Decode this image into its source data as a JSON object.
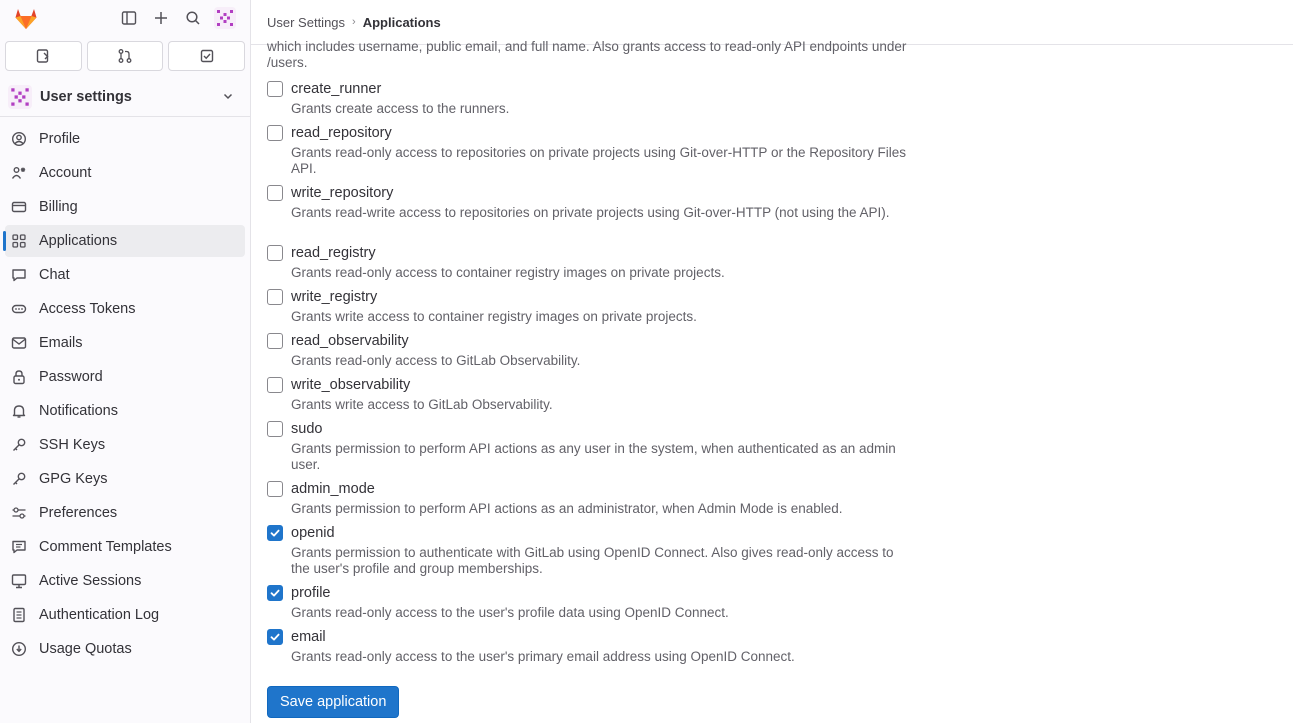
{
  "sidebar": {
    "context_title": "User settings",
    "items": [
      {
        "label": "Profile",
        "icon": "profile-icon"
      },
      {
        "label": "Account",
        "icon": "account-icon"
      },
      {
        "label": "Billing",
        "icon": "billing-icon"
      },
      {
        "label": "Applications",
        "icon": "applications-icon",
        "active": true
      },
      {
        "label": "Chat",
        "icon": "chat-icon"
      },
      {
        "label": "Access Tokens",
        "icon": "token-icon"
      },
      {
        "label": "Emails",
        "icon": "email-icon"
      },
      {
        "label": "Password",
        "icon": "lock-icon"
      },
      {
        "label": "Notifications",
        "icon": "bell-icon"
      },
      {
        "label": "SSH Keys",
        "icon": "key-icon"
      },
      {
        "label": "GPG Keys",
        "icon": "key-icon"
      },
      {
        "label": "Preferences",
        "icon": "preferences-icon"
      },
      {
        "label": "Comment Templates",
        "icon": "comment-icon"
      },
      {
        "label": "Active Sessions",
        "icon": "monitor-icon"
      },
      {
        "label": "Authentication Log",
        "icon": "log-icon"
      },
      {
        "label": "Usage Quotas",
        "icon": "quota-icon"
      }
    ]
  },
  "breadcrumb": {
    "parent": "User Settings",
    "separator": "›",
    "current": "Applications"
  },
  "intro_text": "which includes username, public email, and full name. Also grants access to read-only API endpoints under /users.",
  "scopes": [
    {
      "name": "create_runner",
      "desc": "Grants create access to the runners.",
      "checked": false
    },
    {
      "name": "read_repository",
      "desc": "Grants read-only access to repositories on private projects using Git-over-HTTP or the Repository Files API.",
      "checked": false
    },
    {
      "name": "write_repository",
      "desc": "Grants read-write access to repositories on private projects using Git-over-HTTP (not using the API).",
      "checked": false
    },
    {
      "name": "read_registry",
      "desc": "Grants read-only access to container registry images on private projects.",
      "checked": false
    },
    {
      "name": "write_registry",
      "desc": "Grants write access to container registry images on private projects.",
      "checked": false
    },
    {
      "name": "read_observability",
      "desc": "Grants read-only access to GitLab Observability.",
      "checked": false
    },
    {
      "name": "write_observability",
      "desc": "Grants write access to GitLab Observability.",
      "checked": false
    },
    {
      "name": "sudo",
      "desc": "Grants permission to perform API actions as any user in the system, when authenticated as an admin user.",
      "checked": false
    },
    {
      "name": "admin_mode",
      "desc": "Grants permission to perform API actions as an administrator, when Admin Mode is enabled.",
      "checked": false
    },
    {
      "name": "openid",
      "desc": "Grants permission to authenticate with GitLab using OpenID Connect. Also gives read-only access to the user's profile and group memberships.",
      "checked": true
    },
    {
      "name": "profile",
      "desc": "Grants read-only access to the user's profile data using OpenID Connect.",
      "checked": true
    },
    {
      "name": "email",
      "desc": "Grants read-only access to the user's primary email address using OpenID Connect.",
      "checked": true
    }
  ],
  "save_button_label": "Save application",
  "colors": {
    "accent": "#1f75cb",
    "logo": "#e24329"
  }
}
